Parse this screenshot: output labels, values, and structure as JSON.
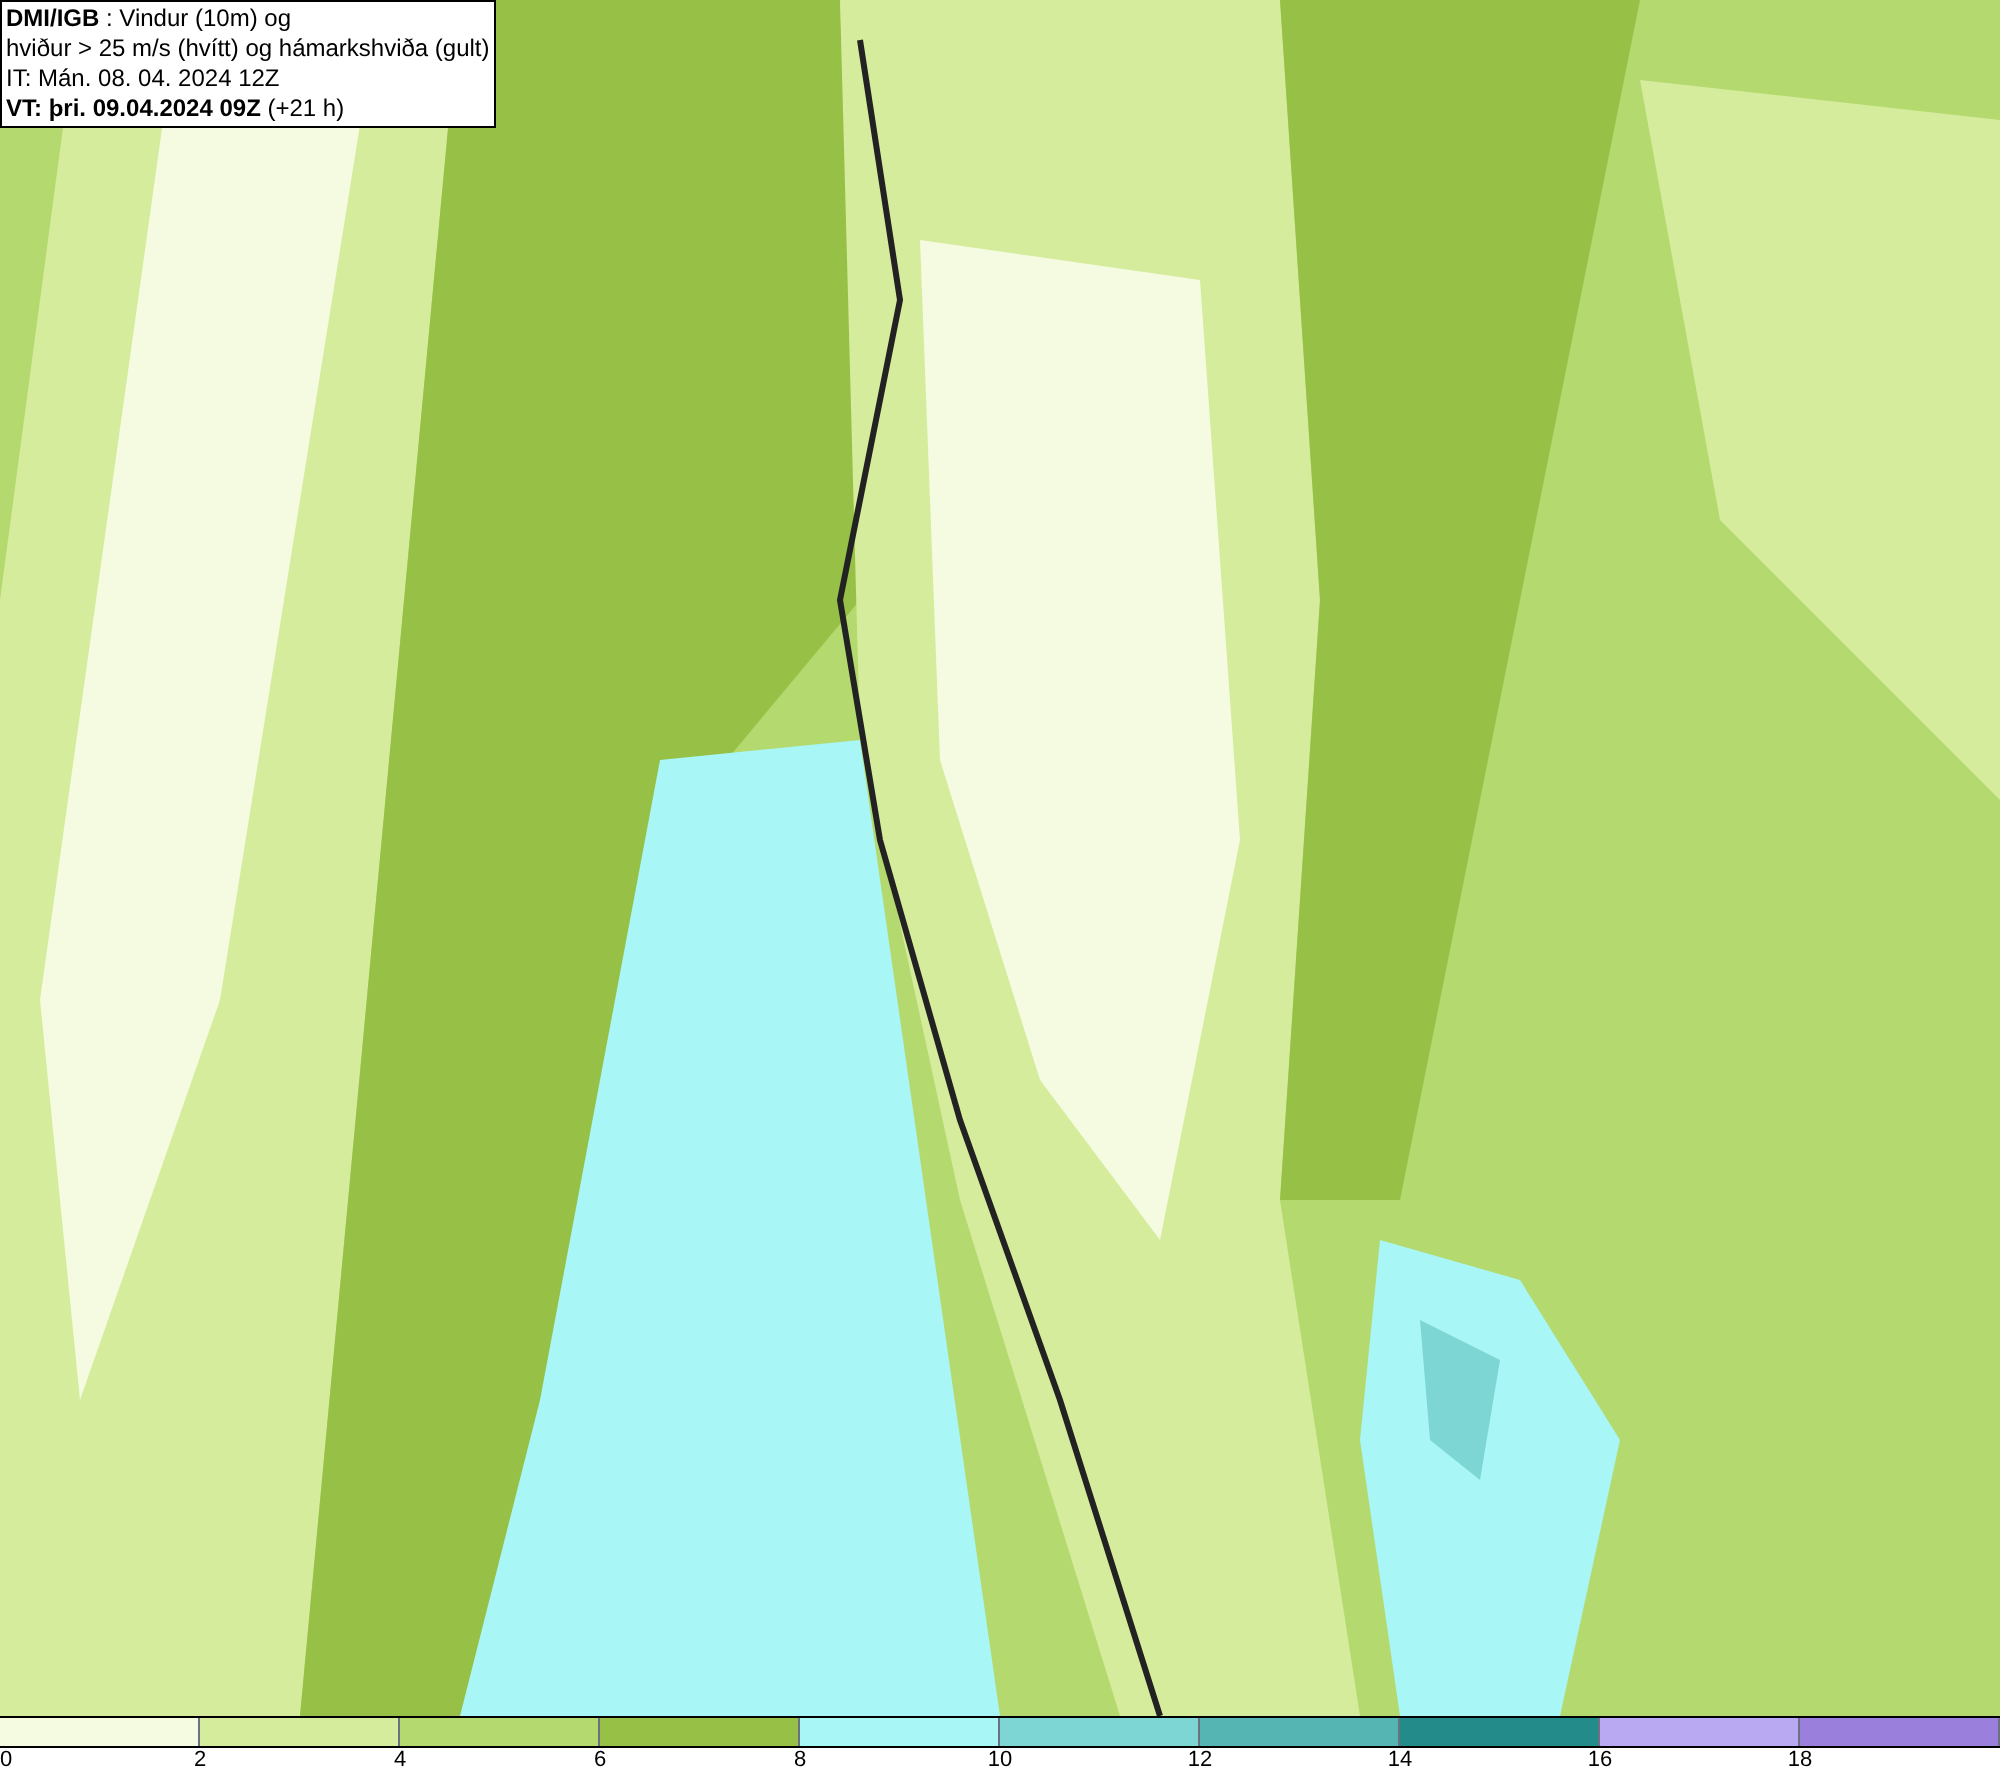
{
  "title_box": {
    "lines": [
      "**DMI/IGB** : Vindur (10m) og",
      "hviður > 25 m/s (hvítt) og hámarkshviða (gult)",
      "IT: Mán. 08. 04. 2024 12Z",
      "**VT: þri. 09.04.2024 09Z** (+21 h)"
    ]
  },
  "legend": {
    "swatches": [
      {
        "color": "#f5fbe0"
      },
      {
        "color": "#d4ec9c"
      },
      {
        "color": "#b4d96e"
      },
      {
        "color": "#96c046"
      },
      {
        "color": "#a8f6f6"
      },
      {
        "color": "#7ed6d4"
      },
      {
        "color": "#55b5b3"
      },
      {
        "color": "#238c8a"
      },
      {
        "color": "#b9a8f2"
      },
      {
        "color": "#9a80dc"
      }
    ],
    "labels": [
      "0",
      "2",
      "4",
      "6",
      "8",
      "10",
      "12",
      "14",
      "16",
      "18"
    ]
  }
}
